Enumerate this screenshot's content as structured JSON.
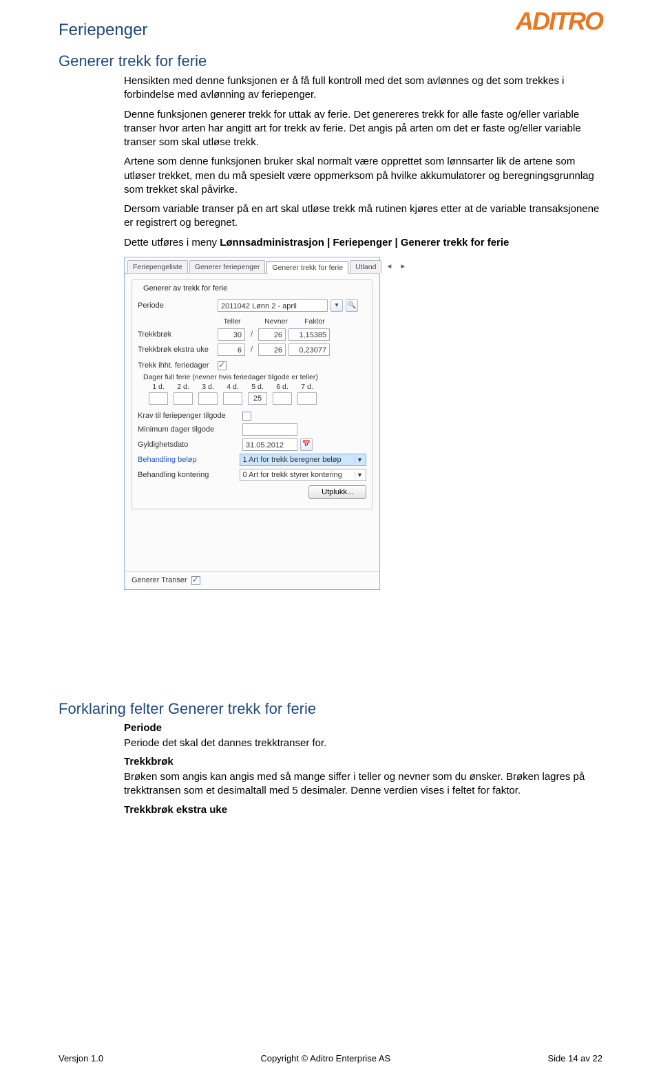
{
  "header": {
    "title": "Feriepenger",
    "logo": "ADITRO"
  },
  "section1": {
    "heading": "Generer trekk for ferie",
    "p1": "Hensikten med denne funksjonen er å få full kontroll med det som avlønnes og det som trekkes i forbindelse med avlønning av feriepenger.",
    "p2": "Denne funksjonen generer trekk for uttak av ferie. Det genereres trekk for alle faste og/eller variable transer hvor arten har angitt art for trekk av ferie. Det angis på arten om det er faste og/eller variable transer som skal utløse trekk.",
    "p3": "Artene som denne funksjonen bruker skal normalt være opprettet som lønnsarter lik de artene som utløser trekket, men du må spesielt være oppmerksom på hvilke akkumulatorer og beregningsgrunnlag som trekket skal påvirke.",
    "p4": "Dersom variable transer på en art skal utløse trekk må rutinen kjøres etter at de variable transaksjonene er registrert og beregnet.",
    "p5_a": "Dette utføres i meny ",
    "p5_b": "Lønnsadministrasjon | Feriepenger | Generer trekk for ferie"
  },
  "app": {
    "tabs": [
      "Feriepengeliste",
      "Generer feriepenger",
      "Generer trekk for ferie",
      "Utland"
    ],
    "active_tab": "Generer trekk for ferie",
    "group_title": "Generer av trekk for ferie",
    "periode_label": "Periode",
    "periode_value": "2011042 Lønn 2 - april",
    "col_teller": "Teller",
    "col_nevner": "Nevner",
    "col_faktor": "Faktor",
    "trekkbrok_label": "Trekkbrøk",
    "trekkbrok_teller": "30",
    "trekkbrok_nevner": "26",
    "trekkbrok_faktor": "1,15385",
    "trekkbrok_eu_label": "Trekkbrøk ekstra uke",
    "trekkbrok_eu_teller": "6",
    "trekkbrok_eu_nevner": "26",
    "trekkbrok_eu_faktor": "0,23077",
    "trekk_ihht_label": "Trekk ihht. feriedager",
    "dager_label": "Dager full ferie (nevner hvis feriedager tilgode er teller)",
    "day_heads": [
      "1 d.",
      "2 d.",
      "3 d.",
      "4 d.",
      "5 d.",
      "6 d.",
      "7 d."
    ],
    "day_values": [
      "",
      "",
      "",
      "",
      "25",
      "",
      ""
    ],
    "krav_label": "Krav til feriepenger tilgode",
    "min_label": "Minimum dager tilgode",
    "gyld_label": "Gyldighetsdato",
    "gyld_value": "31.05.2012",
    "beh_belop_label": "Behandling beløp",
    "beh_belop_value": "1 Art for trekk beregner beløp",
    "beh_kont_label": "Behandling kontering",
    "beh_kont_value": "0 Art for trekk styrer kontering",
    "utplukk_btn": "Utplukk...",
    "gen_transer": "Generer Transer"
  },
  "section2": {
    "heading": "Forklaring felter Generer trekk for ferie",
    "h_periode": "Periode",
    "p_periode": "Periode det skal det dannes trekktranser for.",
    "h_trekkbrok": "Trekkbrøk",
    "p_trekkbrok": "Brøken som angis kan angis med så mange siffer i teller og nevner som du ønsker. Brøken lagres på trekktransen som et desimaltall med 5 desimaler. Denne verdien vises i feltet for faktor.",
    "h_trekkbrok_eu": "Trekkbrøk ekstra uke"
  },
  "footer": {
    "left": "Versjon 1.0",
    "center": "Copyright © Aditro Enterprise AS",
    "right": "Side 14 av 22"
  }
}
